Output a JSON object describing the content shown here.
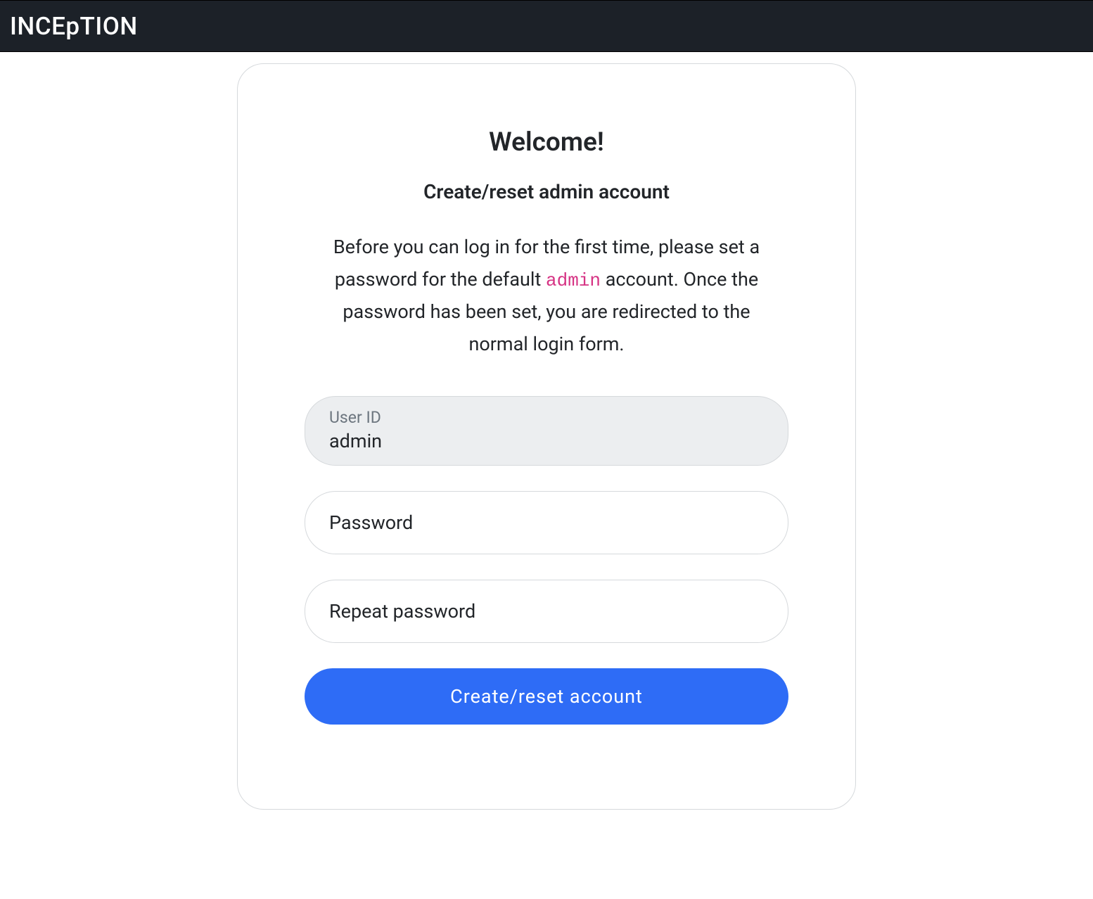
{
  "header": {
    "brand_prefix": "INCE",
    "brand_lower": "p",
    "brand_suffix": "TION"
  },
  "card": {
    "title": "Welcome!",
    "subtitle": "Create/reset admin account",
    "description_part1": "Before you can log in for the first time, please set a password for the default ",
    "description_code": "admin",
    "description_part2": " account. Once the password has been set, you are redirected to the normal login form."
  },
  "form": {
    "userid": {
      "label": "User ID",
      "value": "admin"
    },
    "password": {
      "placeholder": "Password",
      "value": ""
    },
    "repeat_password": {
      "placeholder": "Repeat password",
      "value": ""
    },
    "submit_label": "Create/reset account"
  }
}
